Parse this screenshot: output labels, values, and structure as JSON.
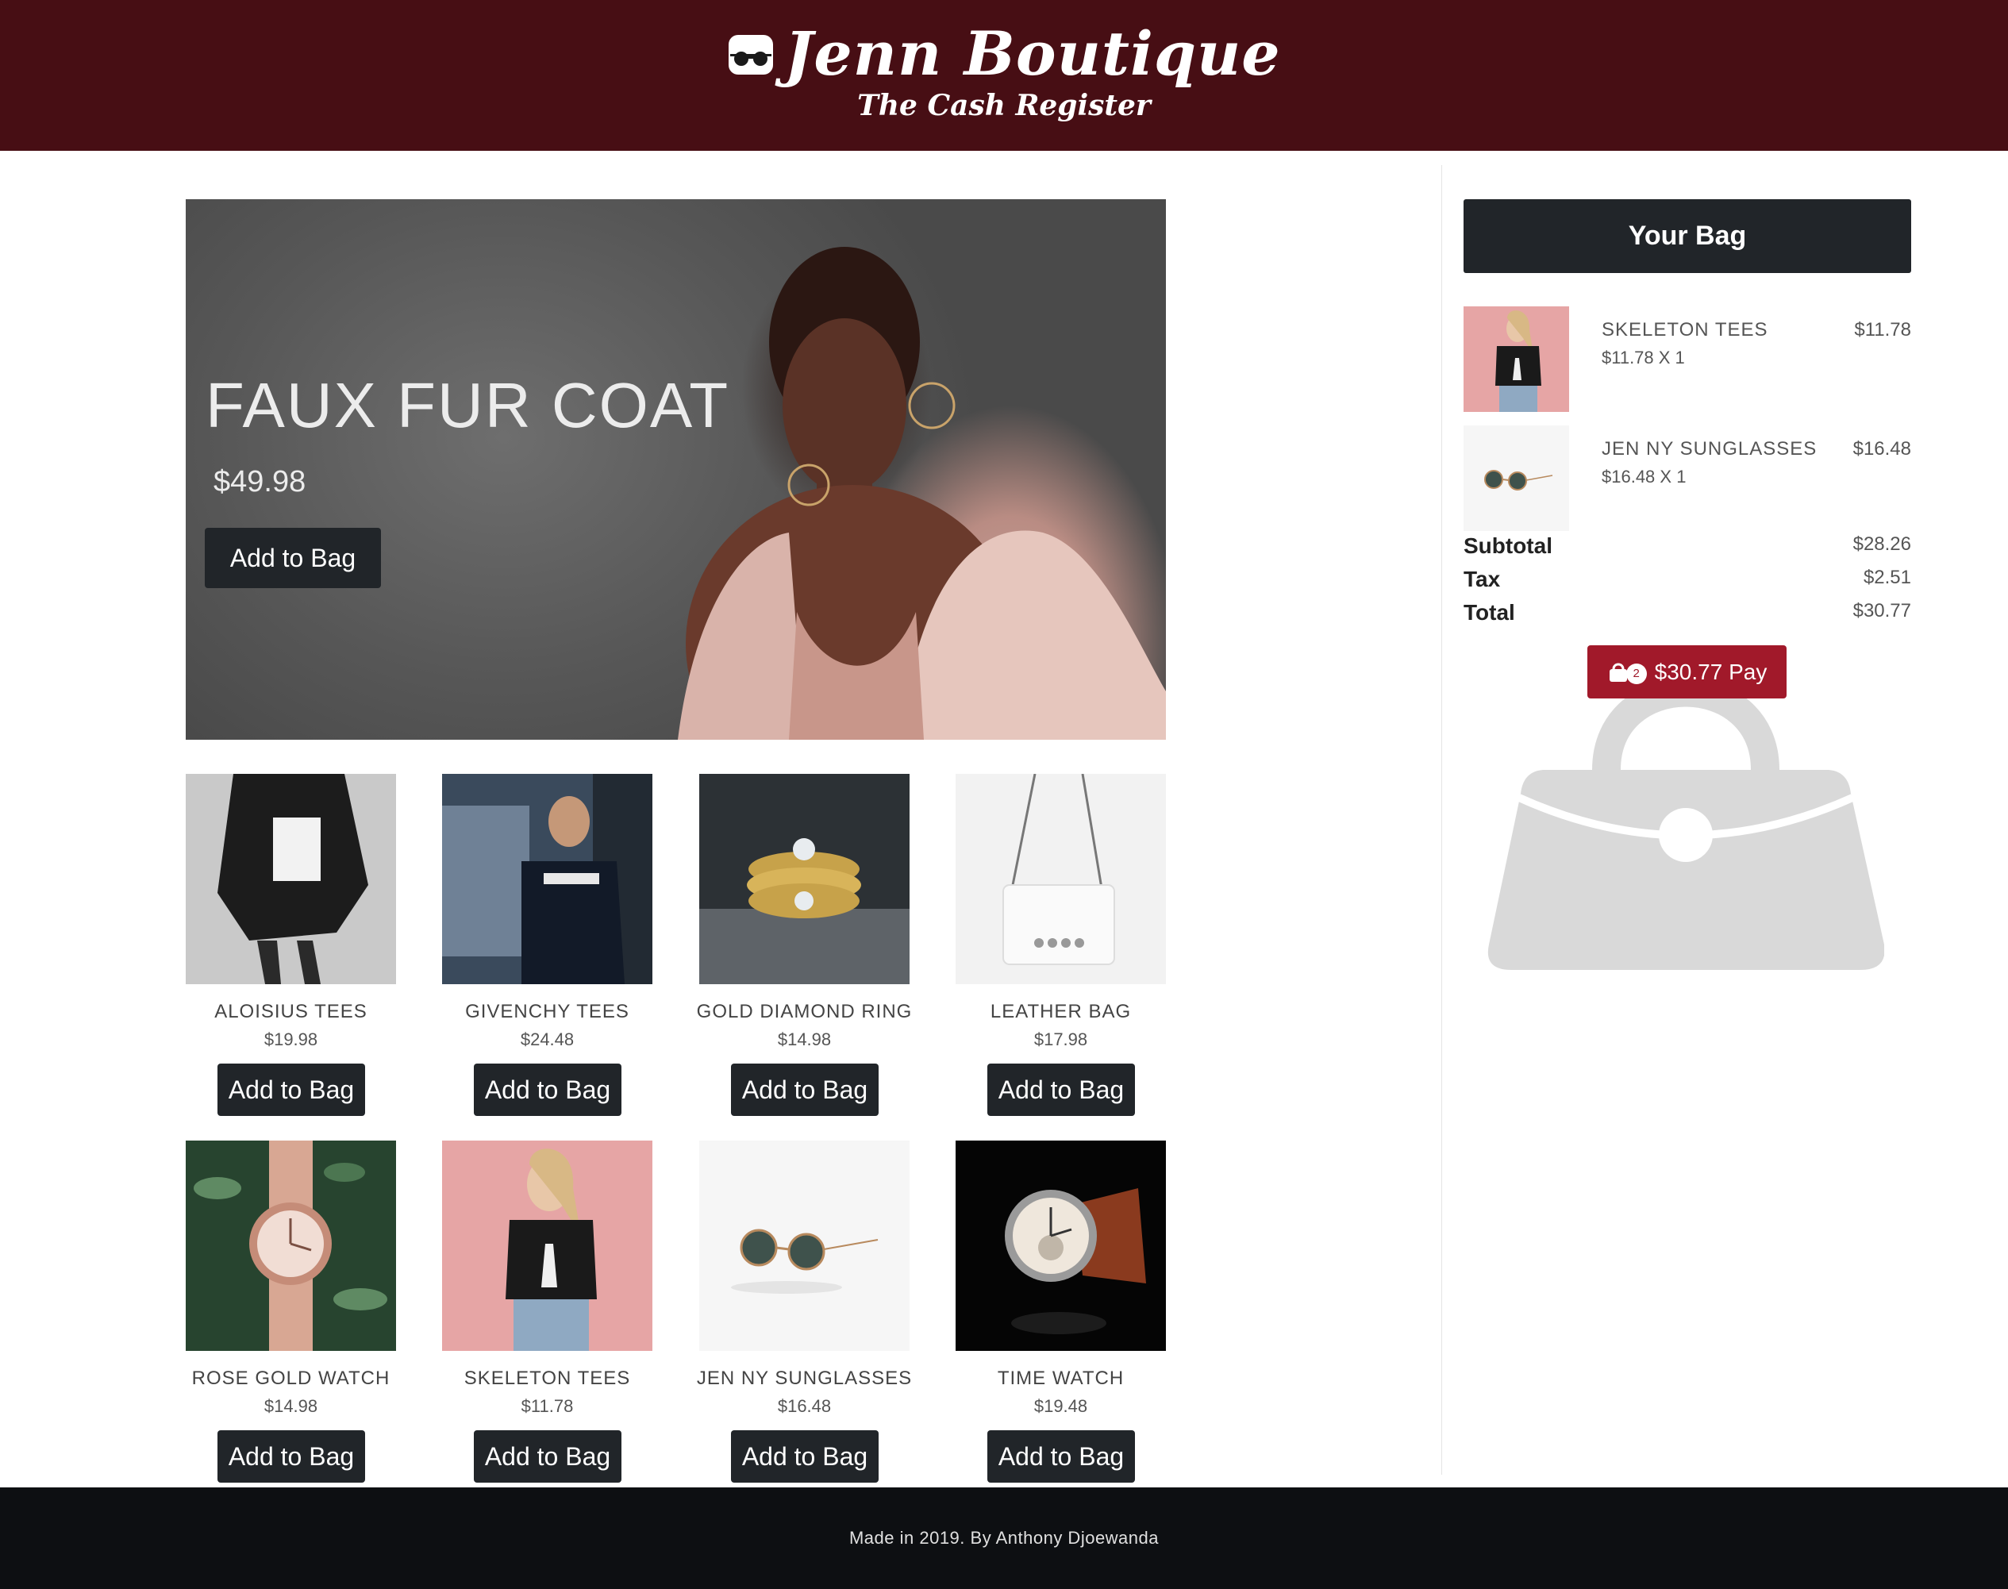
{
  "header": {
    "title": "Jenn Boutique",
    "subtitle": "The Cash Register",
    "logo_icon": "sunglasses-icon",
    "background": "#470e14"
  },
  "hero": {
    "title": "FAUX FUR COAT",
    "price": "$49.98",
    "button_label": "Add to Bag"
  },
  "products": [
    {
      "name": "ALOISIUS TEES",
      "price": "$19.98",
      "button_label": "Add to Bag"
    },
    {
      "name": "GIVENCHY TEES",
      "price": "$24.48",
      "button_label": "Add to Bag"
    },
    {
      "name": "GOLD DIAMOND RING",
      "price": "$14.98",
      "button_label": "Add to Bag"
    },
    {
      "name": "LEATHER BAG",
      "price": "$17.98",
      "button_label": "Add to Bag"
    },
    {
      "name": "ROSE GOLD WATCH",
      "price": "$14.98",
      "button_label": "Add to Bag"
    },
    {
      "name": "SKELETON TEES",
      "price": "$11.78",
      "button_label": "Add to Bag"
    },
    {
      "name": "JEN NY SUNGLASSES",
      "price": "$16.48",
      "button_label": "Add to Bag"
    },
    {
      "name": "TIME WATCH",
      "price": "$19.48",
      "button_label": "Add to Bag"
    }
  ],
  "bag": {
    "title": "Your Bag",
    "items": [
      {
        "name": "SKELETON TEES",
        "qty_line": "$11.78 X 1",
        "total": "$11.78"
      },
      {
        "name": "JEN NY SUNGLASSES",
        "qty_line": "$16.48 X 1",
        "total": "$16.48"
      }
    ],
    "subtotal_label": "Subtotal",
    "subtotal": "$28.26",
    "tax_label": "Tax",
    "tax": "$2.51",
    "total_label": "Total",
    "total": "$30.77",
    "pay_label": "$30.77 Pay",
    "pay_count": "2",
    "pay_color": "#a1192a"
  },
  "footer": {
    "text": "Made in 2019. By Anthony Djoewanda"
  }
}
